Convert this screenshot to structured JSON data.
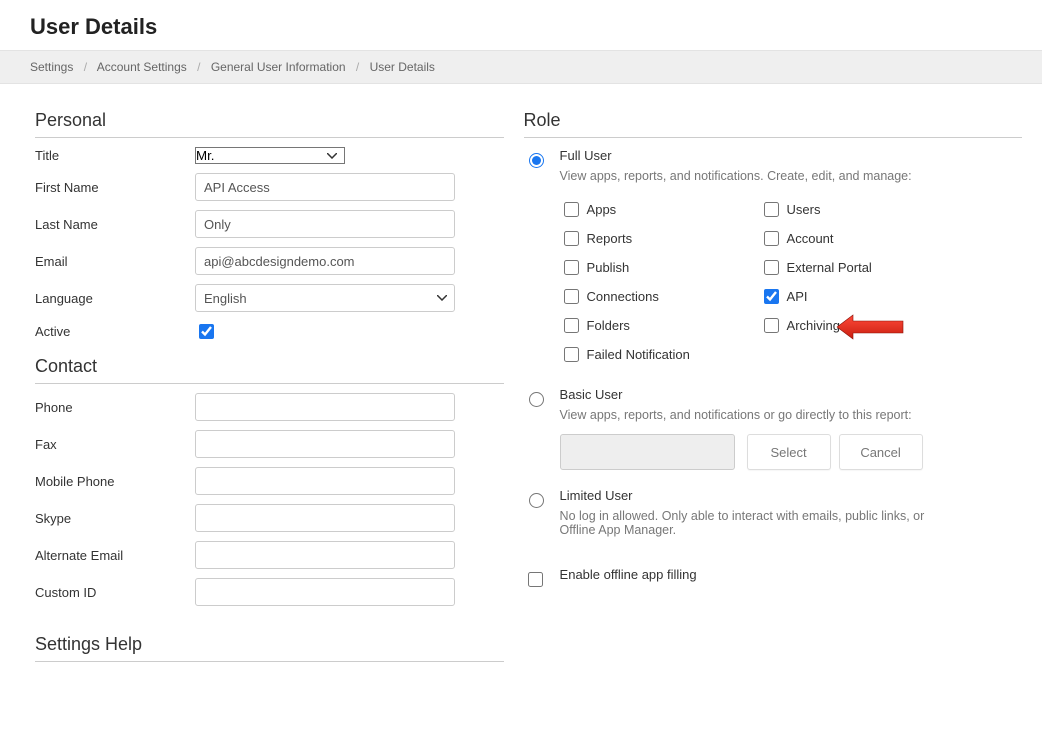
{
  "pageTitle": "User Details",
  "breadcrumbs": {
    "b0": "Settings",
    "b1": "Account Settings",
    "b2": "General User Information",
    "b3": "User Details"
  },
  "sections": {
    "personal": "Personal",
    "contact": "Contact",
    "settingsHelp": "Settings Help",
    "role": "Role"
  },
  "personal": {
    "titleLabel": "Title",
    "titleValue": "Mr.",
    "firstNameLabel": "First Name",
    "firstNameValue": "API Access",
    "lastNameLabel": "Last Name",
    "lastNameValue": "Only",
    "emailLabel": "Email",
    "emailValue": "api@abcdesigndemo.com",
    "languageLabel": "Language",
    "languageValue": "English",
    "activeLabel": "Active"
  },
  "contact": {
    "phone": "Phone",
    "fax": "Fax",
    "mobile": "Mobile Phone",
    "skype": "Skype",
    "altEmail": "Alternate Email",
    "customId": "Custom ID"
  },
  "role": {
    "full": {
      "name": "Full User",
      "desc": "View apps, reports, and notifications. Create, edit, and manage:"
    },
    "basic": {
      "name": "Basic User",
      "desc": "View apps, reports, and notifications or go directly to this report:",
      "select": "Select",
      "cancel": "Cancel"
    },
    "limited": {
      "name": "Limited User",
      "desc": "No log in allowed. Only able to interact with emails, public links, or Offline App Manager."
    },
    "offline": "Enable offline app filling",
    "perms": {
      "apps": "Apps",
      "reports": "Reports",
      "publish": "Publish",
      "connections": "Connections",
      "folders": "Folders",
      "failed": "Failed Notification",
      "users": "Users",
      "account": "Account",
      "portal": "External Portal",
      "api": "API",
      "archiving": "Archiving"
    }
  }
}
